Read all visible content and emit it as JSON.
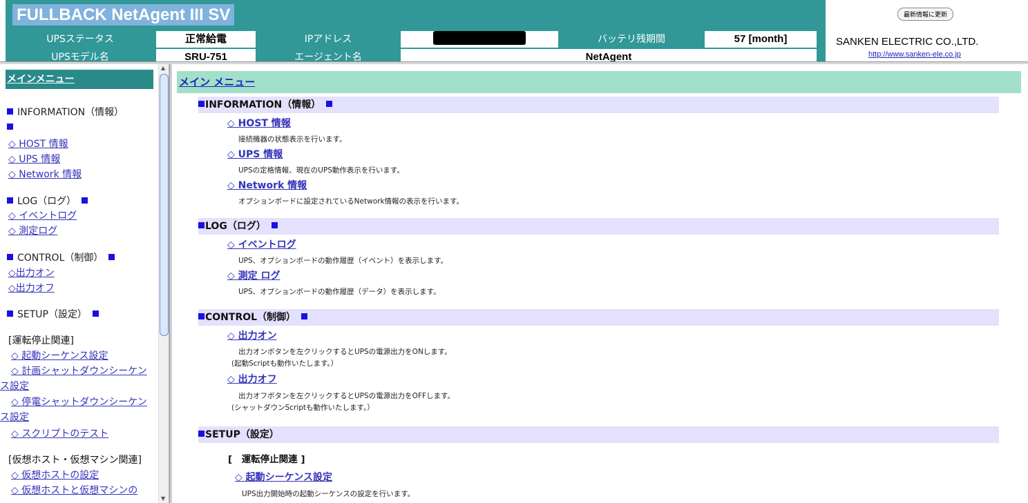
{
  "header": {
    "title": "FULLBACK NetAgent III SV",
    "row1": [
      {
        "label": "UPSステータス",
        "value": "正常給電"
      },
      {
        "label": "IPアドレス",
        "value": ""
      },
      {
        "label": "バッテリ残期間",
        "value": "57 [month]"
      }
    ],
    "row2": [
      {
        "label": "UPSモデル名",
        "value": "SRU-751"
      },
      {
        "label": "エージェント名",
        "value": "NetAgent"
      }
    ],
    "refresh_label": "最新情報に更新",
    "company": "SANKEN ELECTRIC CO.,LTD.",
    "url": "http://www.sanken-ele.co.jp"
  },
  "colors": {
    "header_teal": "#319797",
    "menu_green": "#a2e0c9",
    "section_lavender": "#e3e1fb",
    "square_blue": "#1a10e0"
  },
  "sidebar": {
    "title": "メインメニュー",
    "info_heading": "INFORMATION（情報）",
    "info_items": [
      "◇ HOST 情報",
      "◇ UPS 情報",
      "◇ Network 情報"
    ],
    "log_heading": "LOG（ログ）",
    "log_items": [
      "◇ イベントログ",
      "◇ 測定ログ"
    ],
    "control_heading": "CONTROL（制御）",
    "control_items": [
      "◇出力オン",
      "◇出力オフ"
    ],
    "setup_heading": "SETUP（設定）",
    "setup_group1": "[運転停止関連]",
    "setup_items1": [
      "◇ 起動シーケンス設定",
      "◇ 計画シャットダウンシーケンス設定",
      "◇ 停電シャットダウンシーケンス設定",
      "◇ スクリプトのテスト"
    ],
    "setup_group2": "[仮想ホスト・仮想マシン関連]",
    "setup_items2": [
      "◇ 仮想ホストの設定",
      "◇ 仮想ホストと仮想マシンの"
    ]
  },
  "main": {
    "title": "メイン メニュー",
    "info": {
      "heading": "INFORMATION（情報）",
      "items": [
        {
          "label": "◇ HOST 情報",
          "desc": "接続機器の状態表示を行います。"
        },
        {
          "label": "◇ UPS 情報",
          "desc": "UPSの定格情報、現在のUPS動作表示を行います。"
        },
        {
          "label": "◇ Network 情報",
          "desc": "オプションボードに設定されているNetwork情報の表示を行います。"
        }
      ]
    },
    "log": {
      "heading": "LOG（ログ）",
      "items": [
        {
          "label": "◇ イベントログ",
          "desc": "UPS、オプションボードの動作履歴（イベント）を表示します。"
        },
        {
          "label": "◇ 測定 ログ",
          "desc": "UPS、オプションボードの動作履歴（データ）を表示します。"
        }
      ]
    },
    "control": {
      "heading": "CONTROL（制御）",
      "items": [
        {
          "label": "◇ 出力オン",
          "desc": "出力オンボタンを左クリックするとUPSの電源出力をONします。",
          "note": "(起動Scriptも動作いたします。）"
        },
        {
          "label": "◇ 出力オフ",
          "desc": "出力オフボタンを左クリックするとUPSの電源出力をOFFします。",
          "note": "(シャットダウンScriptも動作いたします。）"
        }
      ]
    },
    "setup": {
      "heading": "SETUP（設定）",
      "subheading": "[　運転停止関連 ]",
      "items": [
        {
          "label": "◇ 起動シーケンス設定",
          "desc": "UPS出力開始時の起動シーケンスの設定を行います。"
        }
      ]
    }
  }
}
